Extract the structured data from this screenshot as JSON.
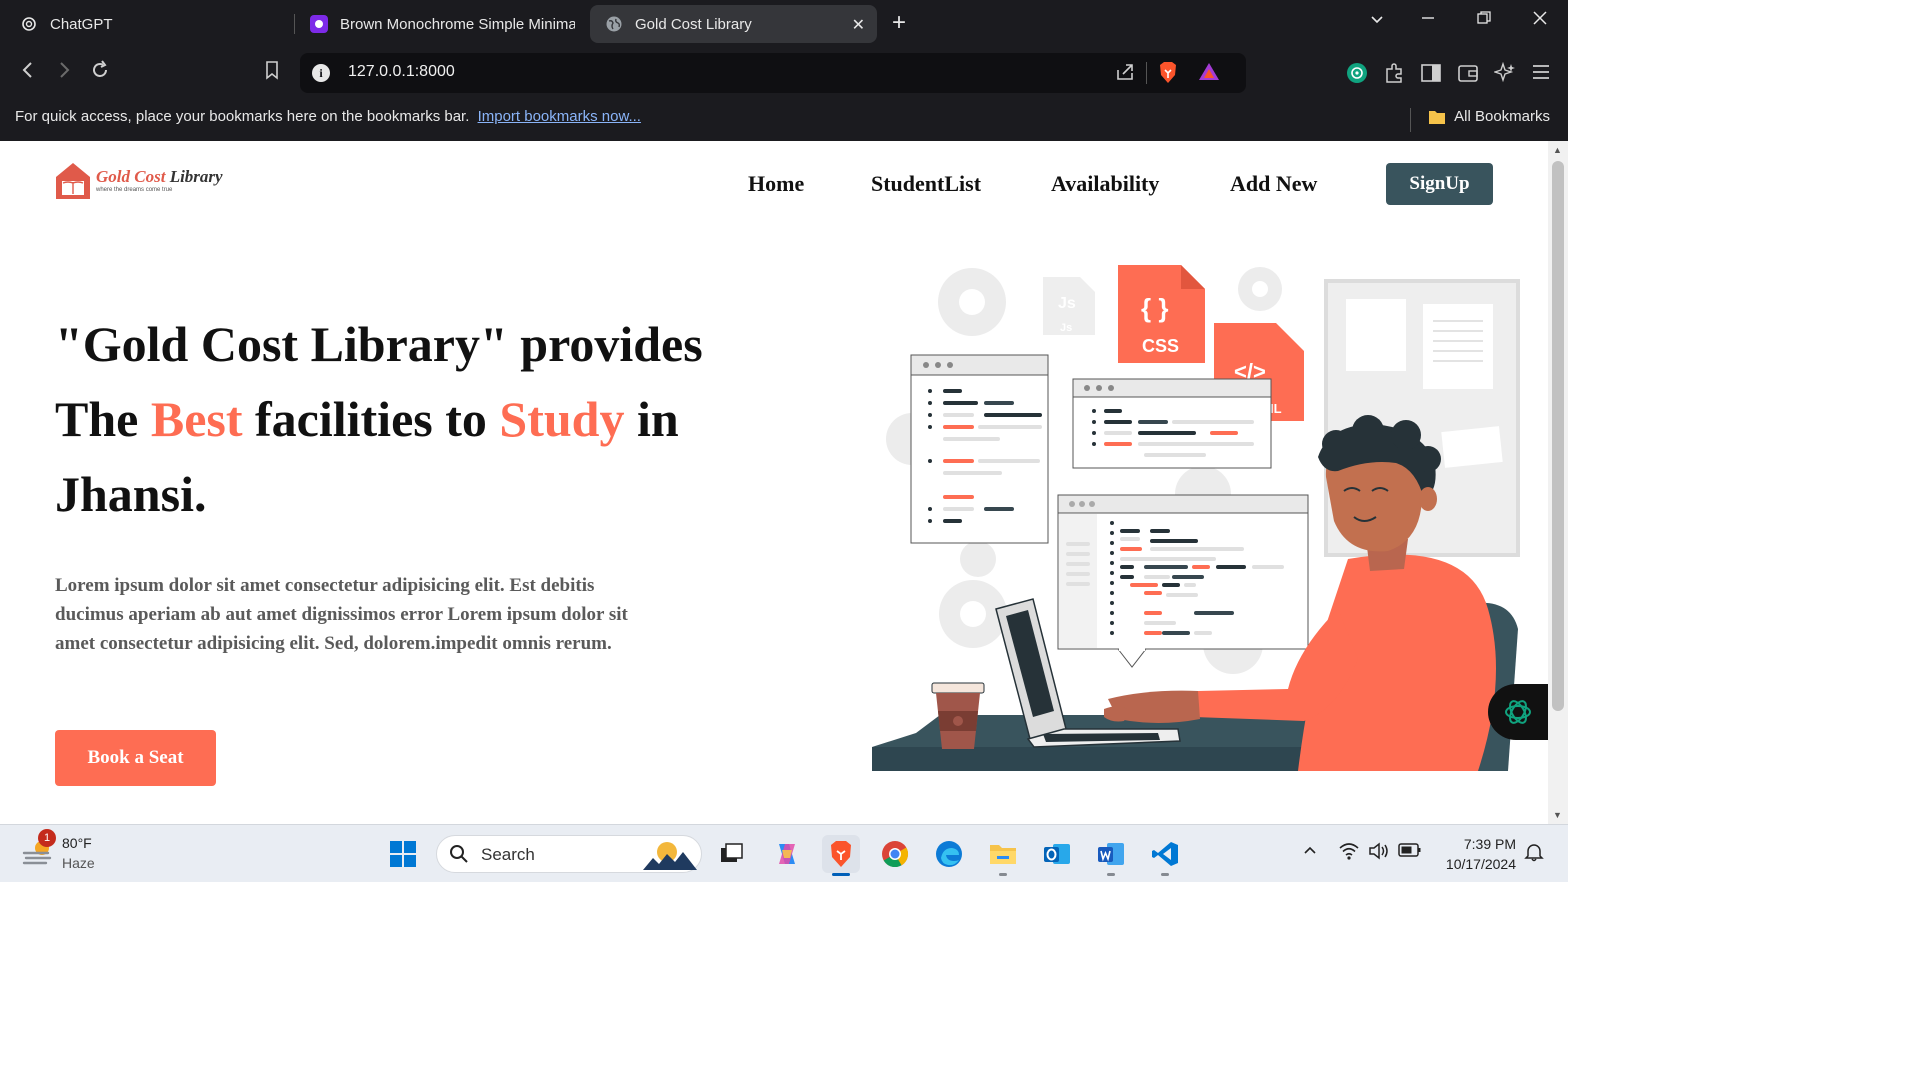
{
  "browser": {
    "tabs": [
      {
        "title": "ChatGPT",
        "icon": "chatgpt-icon"
      },
      {
        "title": "Brown Monochrome Simple Minimal",
        "icon": "canva-icon"
      },
      {
        "title": "Gold Cost Library",
        "icon": "globe-icon",
        "active": true
      }
    ],
    "url": "127.0.0.1:8000",
    "bookmarks_bar": {
      "message": "For quick access, place your bookmarks here on the bookmarks bar.",
      "import_link": "Import bookmarks now...",
      "all_bookmarks": "All Bookmarks"
    }
  },
  "site": {
    "logo": {
      "name_gold": "Gold Cost",
      "name_rest": "Library",
      "tagline": "where the dreams come true"
    },
    "nav": [
      "Home",
      "StudentList",
      "Availability",
      "Add New"
    ],
    "signup": "SignUp",
    "hero": {
      "line1": "\"Gold Cost Library\" provides",
      "line2_a": "The ",
      "line2_accent1": "Best",
      "line2_b": " facilities to ",
      "line2_accent2": "Study",
      "line2_c": " in",
      "line3": "Jhansi.",
      "description": "Lorem ipsum dolor sit amet consectetur adipisicing elit. Est debitis ducimus aperiam ab aut amet dignissimos error Lorem ipsum dolor sit amet consectetur adipisicing elit. Sed, dolorem.impedit omnis rerum.",
      "cta": "Book a Seat"
    },
    "illustration_labels": {
      "css": "CSS",
      "js": "Js",
      "html_tag": "</>",
      "html_suffix": "IL",
      "braces": "{ }"
    },
    "colors": {
      "accent": "#fe6d53",
      "dark_teal": "#39545d"
    }
  },
  "taskbar": {
    "weather": {
      "temp": "80°F",
      "condition": "Haze",
      "badge": "1"
    },
    "search_placeholder": "Search",
    "time": "7:39 PM",
    "date": "10/17/2024"
  }
}
